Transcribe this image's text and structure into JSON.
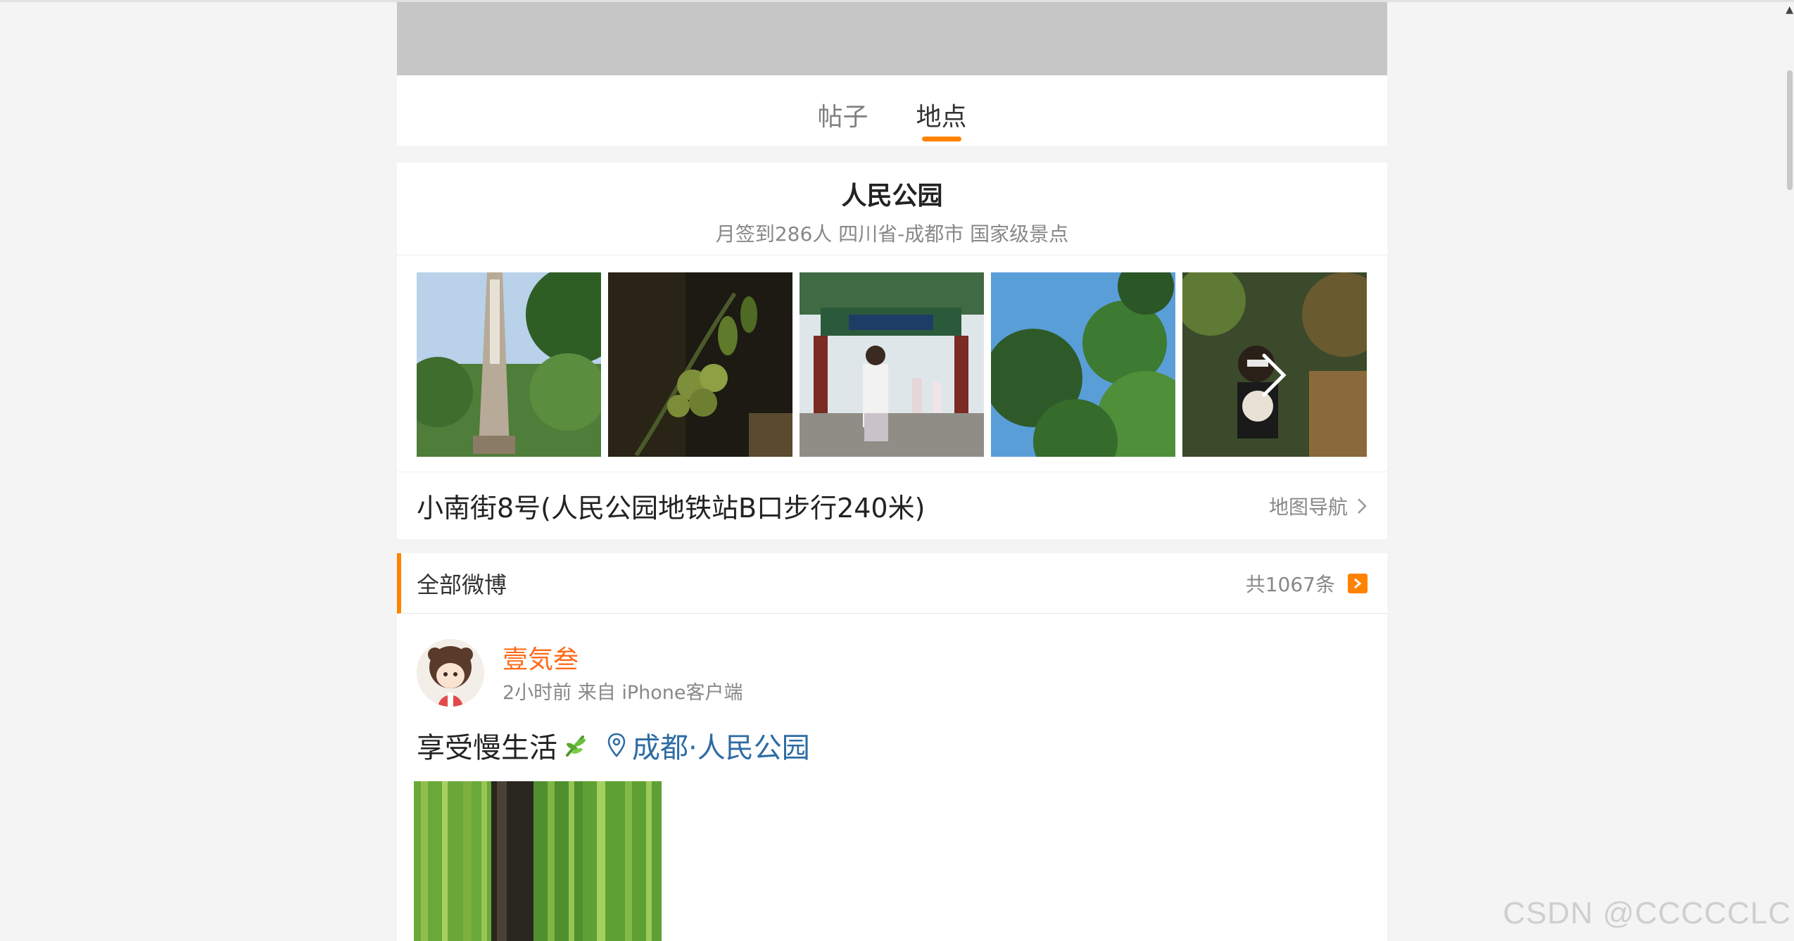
{
  "tabs": [
    {
      "label": "帖子",
      "active": false
    },
    {
      "label": "地点",
      "active": true
    }
  ],
  "location": {
    "title": "人民公园",
    "subtitle": "月签到286人 四川省-成都市 国家级景点",
    "address": "小南街8号(人民公园地铁站B口步行240米)",
    "nav_label": "地图导航"
  },
  "all_weibo": {
    "title": "全部微博",
    "count": "共1067条"
  },
  "post": {
    "username": "壹気叁",
    "meta": "2小时前 来自 iPhone客户端",
    "text": "享受慢生活",
    "emoji": "bamboo-emoji",
    "location_tag": "成都·人民公园"
  },
  "watermark": "CSDN @CCCCCLC",
  "colors": {
    "accent": "#ff8200",
    "username": "#ff6b1a",
    "link": "#2d6ca3"
  }
}
